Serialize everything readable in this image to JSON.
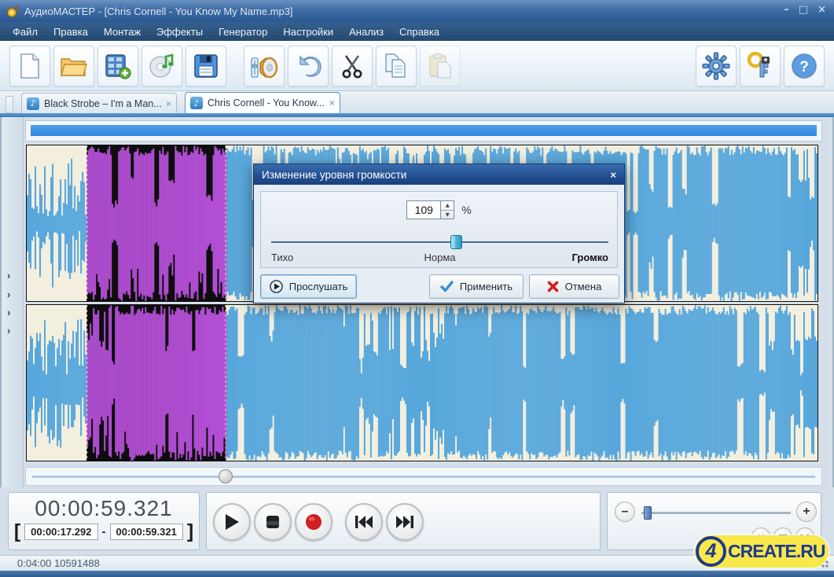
{
  "window": {
    "title": "АудиоМАСТЕР - [Chris Cornell - You Know My Name.mp3]",
    "minimize": "–",
    "maximize": "□",
    "close": "×"
  },
  "menu": {
    "items": [
      "Файл",
      "Правка",
      "Монтаж",
      "Эффекты",
      "Генератор",
      "Настройки",
      "Анализ",
      "Справка"
    ]
  },
  "toolbar": {
    "buttons": [
      "new-file",
      "open-file",
      "import-from-video",
      "grab-from-cd",
      "save-file",
      "volume-effects",
      "undo",
      "cut",
      "copy",
      "paste",
      "settings",
      "registration",
      "help"
    ]
  },
  "tabs": [
    {
      "label": "Black Strobe – I'm a Man...",
      "close": "×",
      "active": false
    },
    {
      "label": "Chris Cornell - You Know...",
      "close": "×",
      "active": true
    }
  ],
  "tab_icon_glyph": "♪",
  "side_panel": {
    "chevron": "›"
  },
  "dialog": {
    "title": "Изменение уровня громкости",
    "close": "×",
    "volume_value": "109",
    "unit": "%",
    "spin_up": "▲",
    "spin_down": "▼",
    "slider_percent": 55,
    "labels": {
      "quiet": "Тихо",
      "normal": "Норма",
      "loud": "Громко"
    },
    "buttons": {
      "listen": "Прослушать",
      "apply": "Применить",
      "cancel": "Отмена"
    }
  },
  "transport": {
    "buttons": [
      "play",
      "stop",
      "record",
      "skip-to-start",
      "skip-to-end"
    ]
  },
  "time_panel": {
    "current": "00:00:59.321",
    "bracket_open": "[",
    "selection_start": "00:00:17.292",
    "separator": "-",
    "selection_end": "00:00:59.321",
    "bracket_close": "]"
  },
  "zoom_panel": {
    "minus": "–",
    "plus": "+",
    "fit_width": "↔",
    "ratio": "1:1"
  },
  "status_bar": {
    "text": "0:04:00 10591488"
  },
  "watermark": {
    "prefix": "4",
    "text": "CREATE.RU"
  },
  "colors": {
    "accent": "#3d97e8",
    "wave": "#57a7dc",
    "wave_selected": "#b44fd6",
    "wave_bg": "#f3efdf",
    "selection_bg": "#0d0d0d",
    "record_red": "#cf1f1f",
    "logo_yellow": "#f8e84a",
    "logo_blue": "#1d3a8f"
  }
}
